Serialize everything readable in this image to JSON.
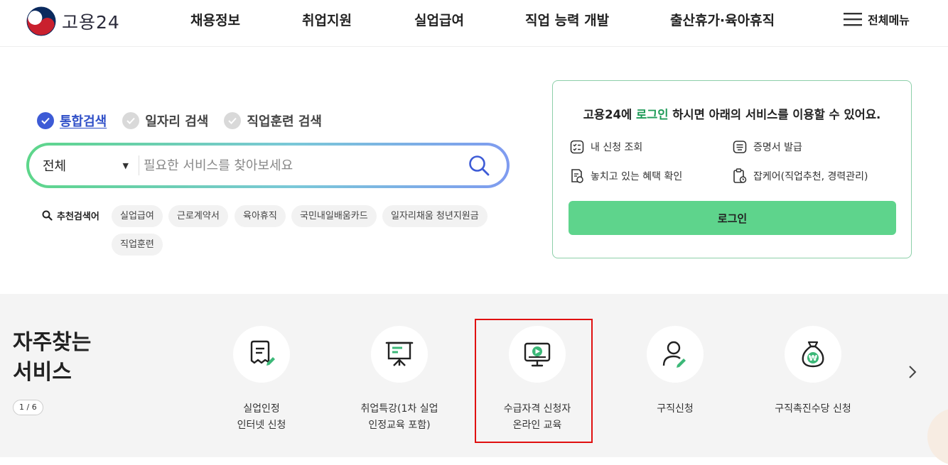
{
  "header": {
    "logo_text": "고용24",
    "nav": [
      "채용정보",
      "취업지원",
      "실업급여",
      "직업 능력 개발",
      "출산휴가·육아휴직"
    ],
    "menu_all": "전체메뉴"
  },
  "search": {
    "tabs": [
      {
        "label": "통합검색",
        "active": true
      },
      {
        "label": "일자리 검색",
        "active": false
      },
      {
        "label": "직업훈련 검색",
        "active": false
      }
    ],
    "select_value": "전체",
    "placeholder": "필요한 서비스를 찾아보세요",
    "reco_title": "추천검색어",
    "keywords": [
      "실업급여",
      "근로계약서",
      "육아휴직",
      "국민내일배움카드",
      "일자리채움 청년지원금",
      "직업훈련"
    ]
  },
  "login": {
    "head_prefix": "고용24에 ",
    "head_highlight": "로그인",
    "head_suffix": " 하시면 아래의 서비스를 이용할 수 있어요.",
    "services": [
      "내 신청 조회",
      "증명서 발급",
      "놓치고 있는 혜택 확인",
      "잡케어(직업추천, 경력관리)"
    ],
    "button": "로그인"
  },
  "frequent": {
    "title_line1": "자주찾는",
    "title_line2": "서비스",
    "pager": "1 / 6",
    "items": [
      {
        "line1": "실업인정",
        "line2": "인터넷 신청",
        "icon": "document-pen-icon"
      },
      {
        "line1": "취업특강(1차 실업",
        "line2": "인정교육 포함)",
        "icon": "presentation-board-icon"
      },
      {
        "line1": "수급자격 신청자",
        "line2": "온라인 교육",
        "icon": "monitor-play-icon"
      },
      {
        "line1": "구직신청",
        "line2": "",
        "icon": "person-pen-icon"
      },
      {
        "line1": "구직촉진수당 신청",
        "line2": "",
        "icon": "money-bag-won-icon"
      }
    ]
  },
  "colors": {
    "accent_green": "#5ed48c",
    "accent_blue": "#3d5bd6",
    "highlight_red": "#e01010"
  }
}
